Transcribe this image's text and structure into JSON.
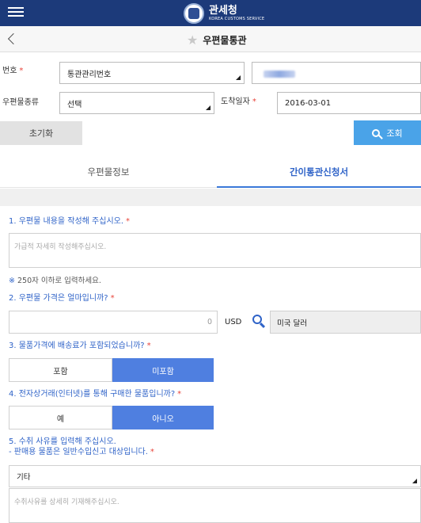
{
  "header": {
    "logo_ko": "관세청",
    "logo_en": "KOREA CUSTOMS SERVICE",
    "page_title": "우편물통관"
  },
  "search": {
    "number_label": "번호",
    "number_type_value": "통관관리번호",
    "number_value": "",
    "mail_type_label": "우편물종류",
    "mail_type_value": "선택",
    "arrival_label": "도착일자",
    "arrival_value": "2016-03-01",
    "required_mark": "*",
    "reset_label": "초기화",
    "search_label": "조회"
  },
  "tabs": {
    "info": "우편물정보",
    "declaration": "간이통관신청서",
    "active": "declaration"
  },
  "form": {
    "q1": {
      "label": "1. 우편물 내용을 작성해 주십시오.",
      "placeholder": "가급적 자세히 작성해주십시오.",
      "note_mark": "※",
      "note": "250자 이하로 입력하세요."
    },
    "q2": {
      "label": "2. 우편물 가격은 얼마입니까?",
      "amount": "0",
      "currency_code": "USD",
      "currency_name": "미국 달러"
    },
    "q3": {
      "label": "3. 물품가격에 배송료가 포함되었습니까?",
      "options": [
        "포함",
        "미포함"
      ],
      "selected": "미포함"
    },
    "q4": {
      "label": "4. 전자상거래(인터넷)를 통해 구매한 물품입니까?",
      "options": [
        "예",
        "아니오"
      ],
      "selected": "아니오"
    },
    "q5": {
      "label_line1": "5. 수취 사유를 입력해 주십시오.",
      "label_line2": "- 판매용 물품은 일반수입신고 대상입니다.",
      "reason_value": "기타",
      "detail_placeholder": "수취사유를 상세히 기재해주십시오."
    }
  },
  "colors": {
    "header_bg": "#1c3a7a",
    "accent_blue": "#4f7fe0",
    "search_button": "#4aa3e8",
    "required_red": "#e8443a",
    "question_text": "#2f63c8"
  }
}
